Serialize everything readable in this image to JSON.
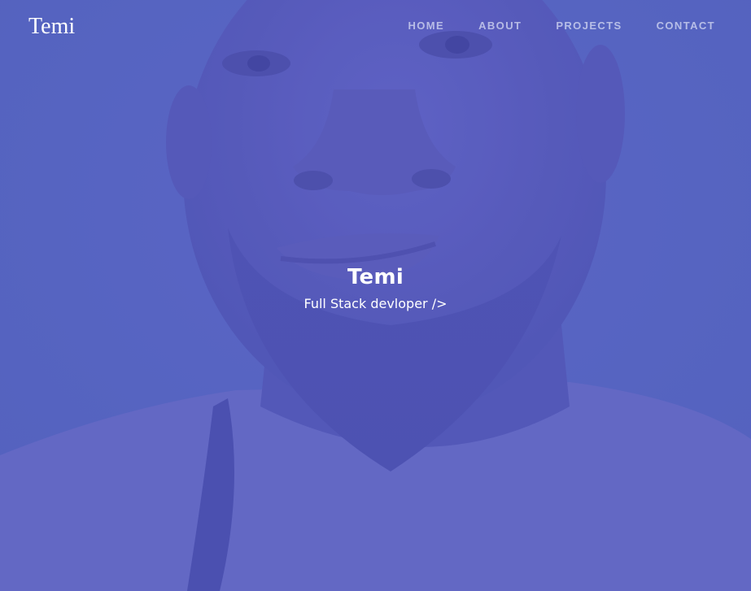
{
  "navbar": {
    "brand": "Temi",
    "links": [
      {
        "label": "HOME"
      },
      {
        "label": "ABOUT"
      },
      {
        "label": "PROJECTS"
      },
      {
        "label": "CONTACT"
      }
    ]
  },
  "hero": {
    "name": "Temi",
    "role": "Full Stack devloper />",
    "photo": "portrait-photo"
  },
  "colors": {
    "overlay": "#5563c1",
    "text": "#ffffff",
    "nav_text": "#dce0f5"
  }
}
